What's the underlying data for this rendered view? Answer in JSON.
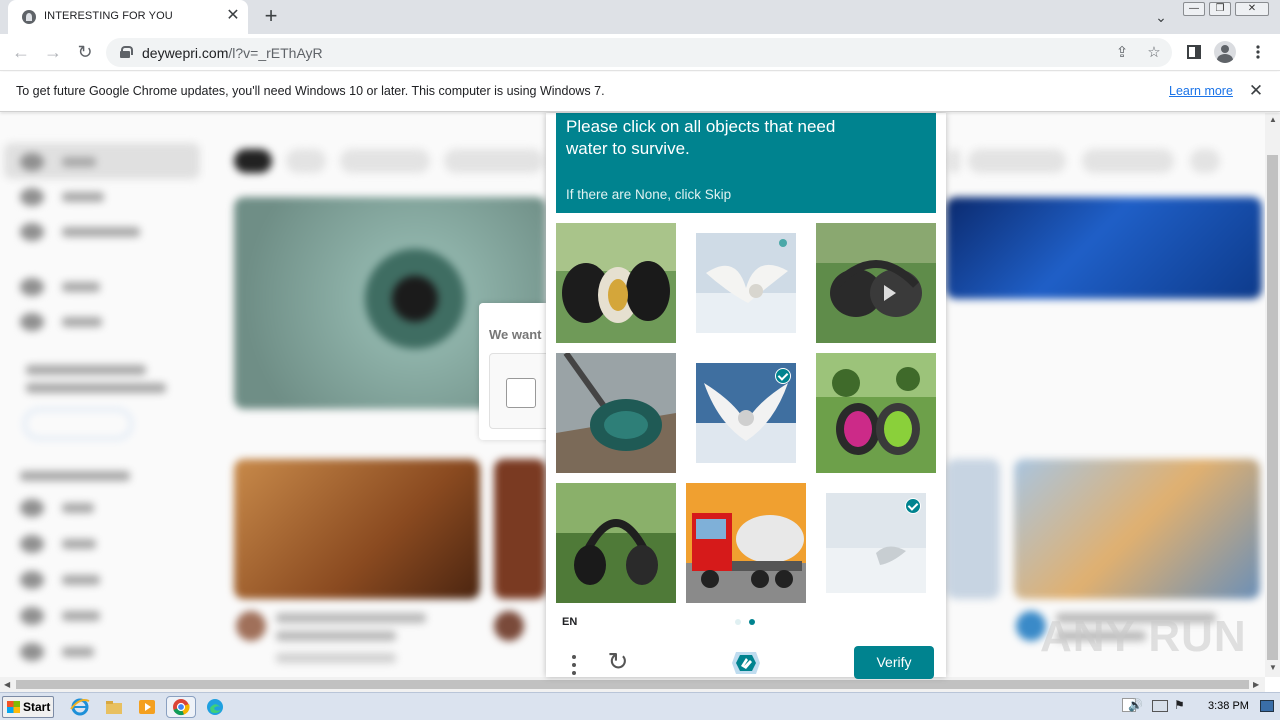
{
  "browser": {
    "tab_title": "INTERESTING FOR YOU",
    "tab_close": "✕",
    "new_tab": "+",
    "tab_search": "⌄",
    "url_host": "deywepri.com",
    "url_path": "/l?v=_rEThAyR",
    "back": "←",
    "forward": "→",
    "reload": "↻",
    "share": "⇪",
    "bookmark": "☆",
    "window_min": "—",
    "window_restore": "❐",
    "window_close": "✕"
  },
  "infobar": {
    "message": "To get future Google Chrome updates, you'll need Windows 10 or later. This computer is using Windows 7.",
    "learn_more": "Learn more",
    "close": "✕"
  },
  "behind_dialog": {
    "heading": "We want"
  },
  "captcha": {
    "prompt_line": "Please click on all objects that need water to survive.",
    "prompt_sub": "If there are None, click Skip",
    "language": "EN",
    "verify_label": "Verify",
    "refresh": "↻",
    "tiles": [
      {
        "label": "headphones-on-grass",
        "selected": false
      },
      {
        "label": "snowy-owl",
        "selected": false
      },
      {
        "label": "headphones-on-grass",
        "selected": false
      },
      {
        "label": "vacuum-cleaner",
        "selected": false
      },
      {
        "label": "snowy-owl-wings",
        "selected": true
      },
      {
        "label": "headphones-on-grass",
        "selected": false
      },
      {
        "label": "headphones-on-grass",
        "selected": false
      },
      {
        "label": "cement-mixer-truck",
        "selected": false
      },
      {
        "label": "snowy-owl-landing",
        "selected": true
      }
    ],
    "accent_color": "#00838f"
  },
  "watermark": "ANY RUN",
  "taskbar": {
    "start_label": "Start",
    "clock": "3:38 PM"
  }
}
